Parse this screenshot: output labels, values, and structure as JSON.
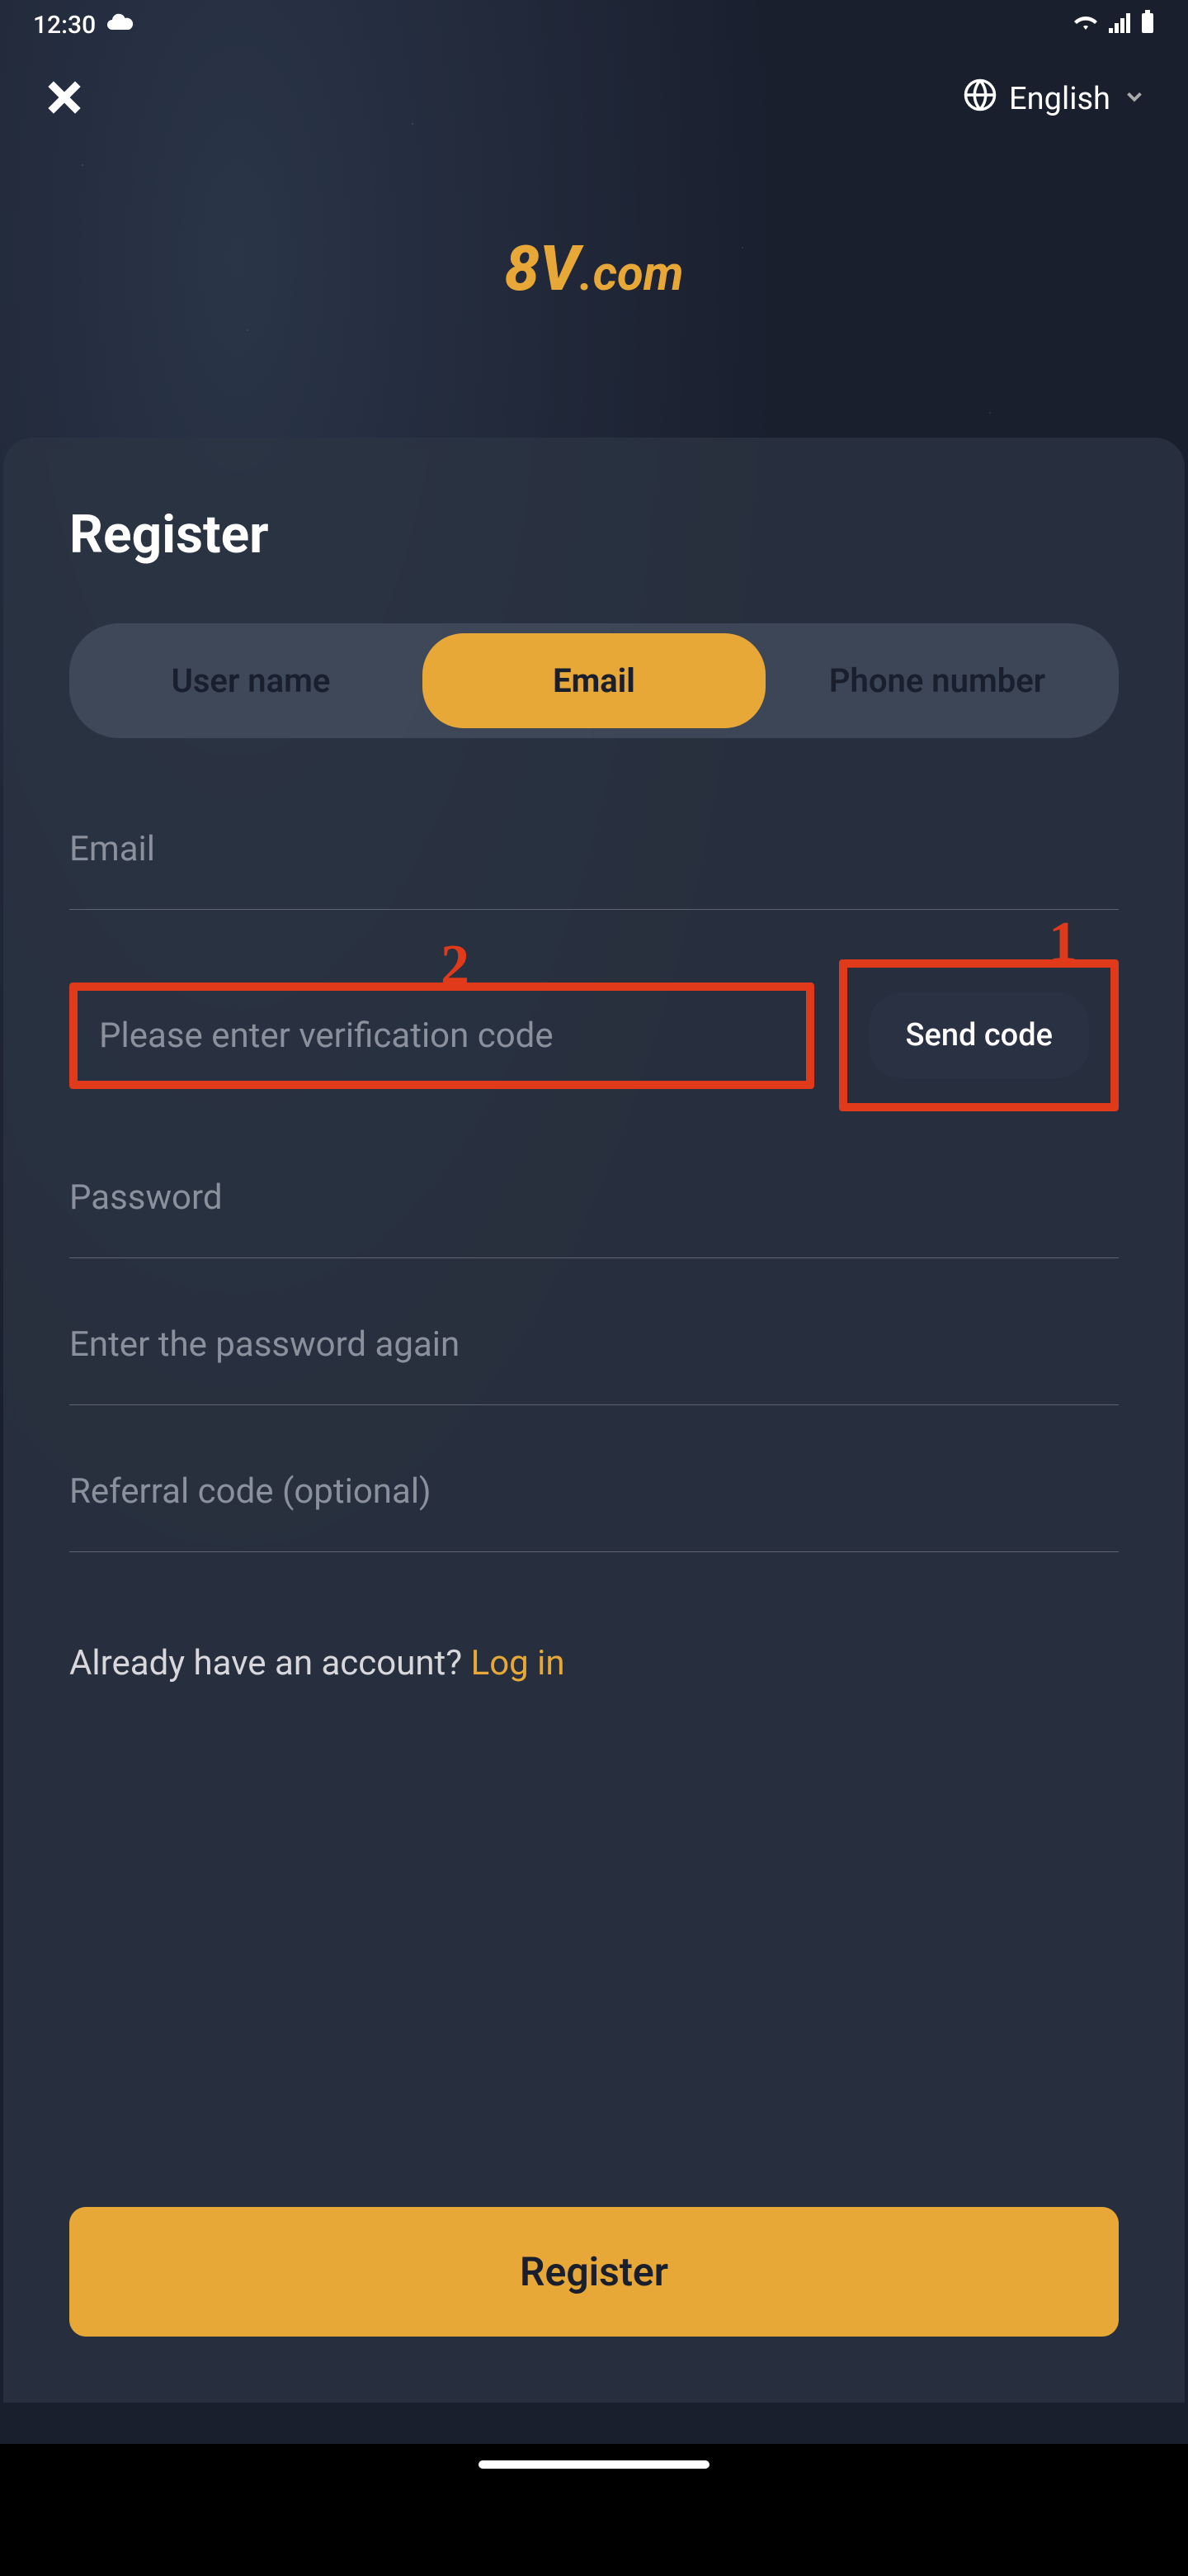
{
  "status_bar": {
    "time": "12:30"
  },
  "header": {
    "language": "English"
  },
  "logo": {
    "part1": "8V",
    "part2": ".com"
  },
  "register": {
    "title": "Register",
    "tabs": {
      "username": "User name",
      "email": "Email",
      "phone": "Phone number"
    },
    "email_placeholder": "Email",
    "verify_placeholder": "Please enter verification code",
    "send_code_label": "Send code",
    "password_placeholder": "Password",
    "password_again_placeholder": "Enter the password again",
    "referral_placeholder": "Referral code (optional)",
    "already_text": "Already have an account? ",
    "login_link": "Log in",
    "register_button": "Register"
  },
  "annotations": {
    "num1": "1",
    "num2": "2"
  }
}
